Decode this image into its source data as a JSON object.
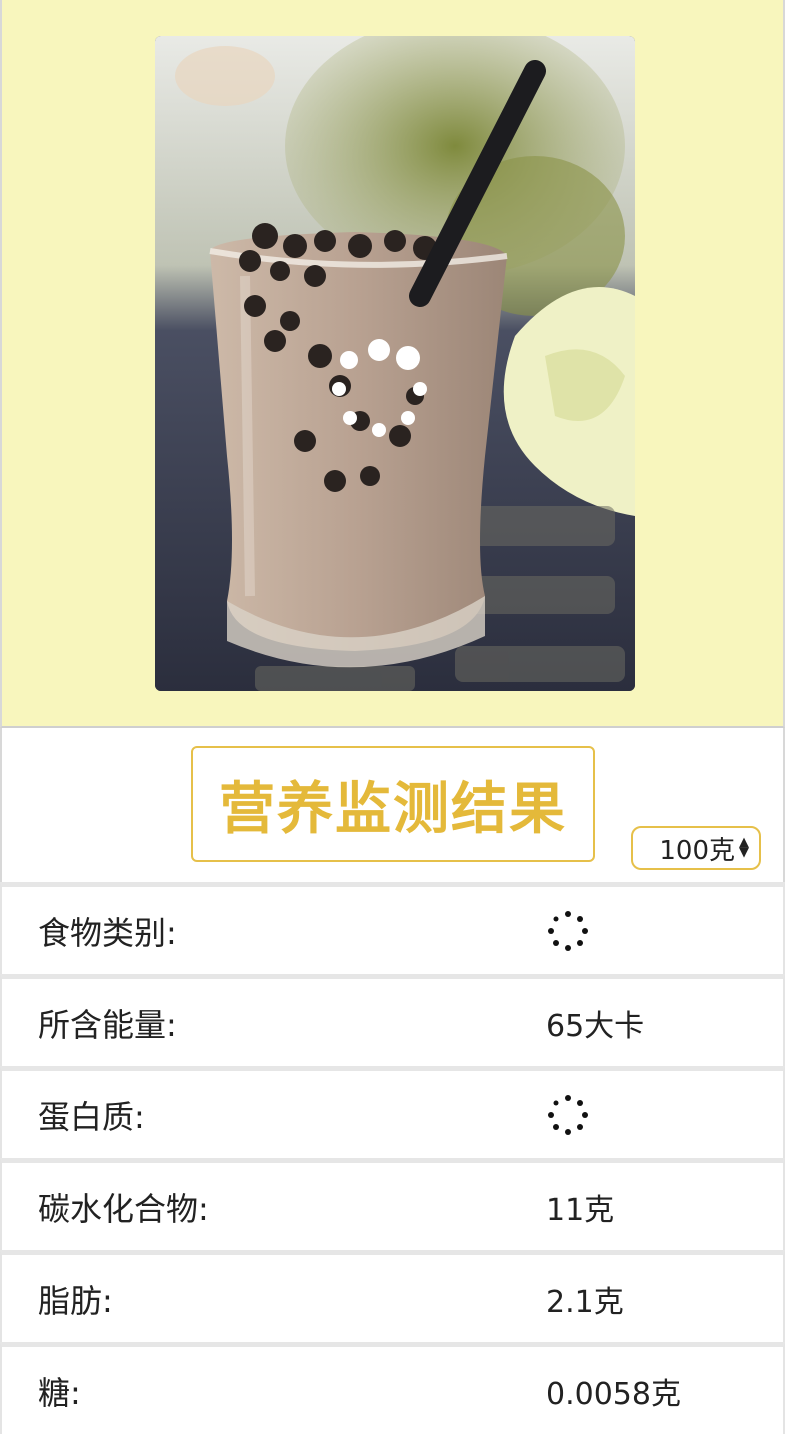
{
  "image_section": {
    "photo_alt": "milk tea with tapioca pearls"
  },
  "header": {
    "title": "营养监测结果",
    "weight_select": {
      "selected": "100克"
    }
  },
  "nutrition": {
    "rows": [
      {
        "label": "食物类别:",
        "value": "",
        "loading": true
      },
      {
        "label": "所含能量:",
        "value": "65大卡",
        "loading": false
      },
      {
        "label": "蛋白质:",
        "value": "",
        "loading": true
      },
      {
        "label": "碳水化合物:",
        "value": "11克",
        "loading": false
      },
      {
        "label": "脂肪:",
        "value": "2.1克",
        "loading": false
      },
      {
        "label": "糖:",
        "value": "0.0058克",
        "loading": false
      }
    ]
  },
  "colors": {
    "panel_bg": "#f8f6bd",
    "accent": "#e4b93a"
  }
}
